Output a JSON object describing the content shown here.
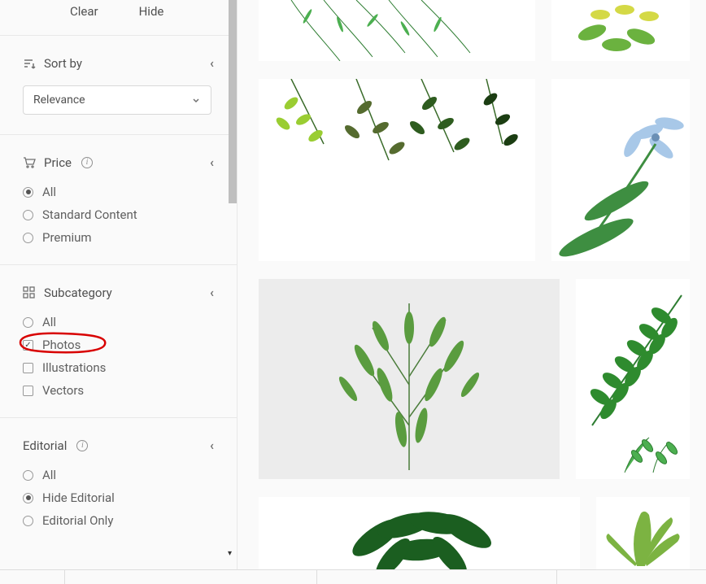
{
  "top_actions": {
    "clear": "Clear",
    "hide": "Hide"
  },
  "sort": {
    "title": "Sort by",
    "selected": "Relevance"
  },
  "price": {
    "title": "Price",
    "options": [
      {
        "label": "All",
        "checked": true
      },
      {
        "label": "Standard Content",
        "checked": false
      },
      {
        "label": "Premium",
        "checked": false
      }
    ]
  },
  "subcategory": {
    "title": "Subcategory",
    "options": [
      {
        "label": "All",
        "checked": false
      },
      {
        "label": "Photos",
        "checked": true
      },
      {
        "label": "Illustrations",
        "checked": false
      },
      {
        "label": "Vectors",
        "checked": false
      }
    ]
  },
  "editorial": {
    "title": "Editorial",
    "options": [
      {
        "label": "All",
        "checked": false
      },
      {
        "label": "Hide Editorial",
        "checked": true
      },
      {
        "label": "Editorial Only",
        "checked": false
      }
    ]
  }
}
